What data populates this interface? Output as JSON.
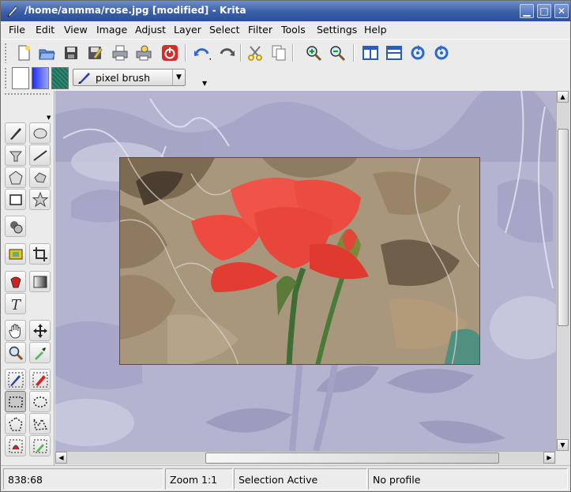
{
  "window": {
    "title": "/home/anmma/rose.jpg [modified] - Krita",
    "controls": {
      "minimize": "▁",
      "maximize": "□",
      "close": "✕"
    }
  },
  "menu": [
    {
      "label": "File",
      "key": "F"
    },
    {
      "label": "Edit",
      "key": "E"
    },
    {
      "label": "View",
      "key": "V"
    },
    {
      "label": "Image",
      "key": "I"
    },
    {
      "label": "Adjust",
      "key": "A"
    },
    {
      "label": "Layer",
      "key": "L"
    },
    {
      "label": "Select",
      "key": "S"
    },
    {
      "label": "Filter",
      "key": "r"
    },
    {
      "label": "Tools",
      "key": "T"
    },
    {
      "label": "Settings",
      "key": "S"
    },
    {
      "label": "Help",
      "key": "H"
    }
  ],
  "toolbar": {
    "icons": [
      "new-icon",
      "open-icon",
      "save-icon",
      "save-as-icon",
      "print-icon",
      "print-preview-icon",
      "quit-icon",
      "undo-icon",
      "redo-icon",
      "cut-icon",
      "copy-icon",
      "zoom-in-icon",
      "zoom-out-icon",
      "layout-vertical-icon",
      "layout-horizontal-icon",
      "rotate-cw-icon",
      "rotate-ccw-icon"
    ]
  },
  "brush": {
    "selected": "pixel brush",
    "foreground_color": "#ffffff",
    "gradient_colors": [
      "#1c2cf0",
      "#9aa8ff"
    ],
    "pattern_color": "#1e6b5a"
  },
  "toolbox": {
    "tools": [
      "freehand-brush",
      "ellipse",
      "fill",
      "line",
      "polygon",
      "polyline",
      "rectangle",
      "star",
      "duplicate",
      "crop-to-layer",
      "crop",
      "color-picker-bucket",
      "gradient",
      "text",
      "pan",
      "move",
      "zoom",
      "eyedropper",
      "contiguous-select",
      "color-select",
      "rect-select",
      "ellipse-select",
      "polygon-select",
      "outline-select",
      "select-brush",
      "select-eraser"
    ]
  },
  "canvas": {
    "background_tint": "#b7b7d2",
    "selection_color": "#d01818"
  },
  "status": {
    "coordinates": "838:68",
    "zoom": "Zoom 1:1",
    "selection": "Selection Active",
    "profile": "No profile"
  }
}
